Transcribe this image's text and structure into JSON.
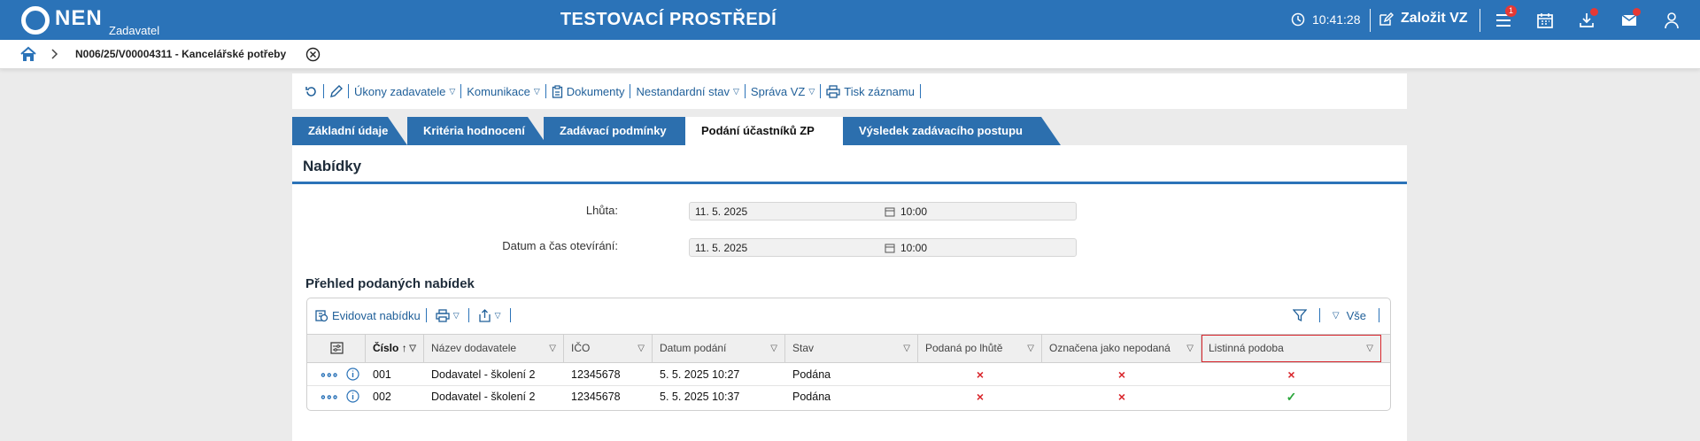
{
  "header": {
    "logo_text": "NEN",
    "logo_sub": "Zadavatel",
    "env_title": "TESTOVACÍ PROSTŘEDÍ",
    "time": "10:41:28",
    "create_label": "Založit VZ",
    "menu_badge": "1"
  },
  "breadcrumb": {
    "title": "N006/25/V00004311 - Kancelářské potřeby"
  },
  "toolbar": {
    "items": [
      "Úkony zadavatele",
      "Komunikace",
      "Dokumenty",
      "Nestandardní stav",
      "Správa VZ",
      "Tisk záznamu"
    ]
  },
  "tabs": [
    "Základní údaje",
    "Kritéria hodnocení",
    "Zadávací podmínky",
    "Podání účastníků ZP",
    "Výsledek zadávacího postupu"
  ],
  "active_tab": "Podání účastníků ZP",
  "panel": {
    "title": "Nabídky",
    "deadline_label": "Lhůta:",
    "deadline_date": "11. 5. 2025",
    "deadline_time": "10:00",
    "opening_label": "Datum a čas otevírání:",
    "opening_date": "11. 5. 2025",
    "opening_time": "10:00",
    "section_title": "Přehled podaných nabídek"
  },
  "grid": {
    "register_label": "Evidovat nabídku",
    "all_label": "Vše",
    "columns": [
      "Číslo",
      "Název dodavatele",
      "IČO",
      "Datum podání",
      "Stav",
      "Podaná po lhůtě",
      "Označena jako nepodaná",
      "Listinná podoba"
    ],
    "rows": [
      {
        "cislo": "001",
        "nazev": "Dodavatel - školení 2",
        "ico": "12345678",
        "datum": "5. 5. 2025 10:27",
        "stav": "Podána",
        "po_lhute": "×",
        "nepodana": "×",
        "listinna": "×"
      },
      {
        "cislo": "002",
        "nazev": "Dodavatel - školení 2",
        "ico": "12345678",
        "datum": "5. 5. 2025 10:37",
        "stav": "Podána",
        "po_lhute": "×",
        "nepodana": "×",
        "listinna": "✓"
      }
    ]
  },
  "colors": {
    "primary": "#2b73b8",
    "tab": "#2c6fae",
    "cross": "#d9262c",
    "check": "#2aa63b",
    "badge": "#e53935"
  }
}
